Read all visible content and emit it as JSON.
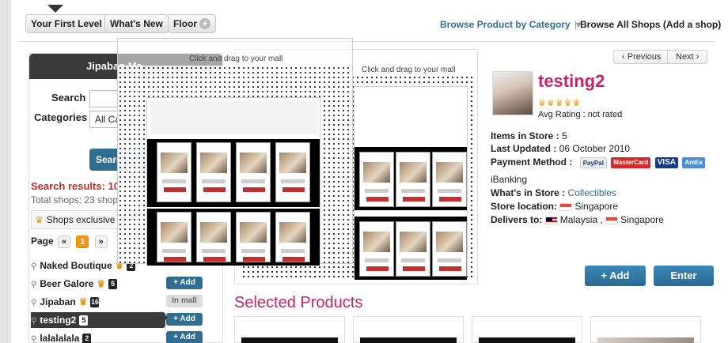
{
  "topnav": {
    "your_first_level": "Your First Level",
    "whats_new": "What's New",
    "floor": "Floor",
    "browse_category": "Browse Product by Category",
    "browse_all": "Browse All Shops (Add a shop)"
  },
  "left": {
    "header": "Jipaban Ma",
    "search_label": "Search",
    "categories_label": "Categories",
    "categories_value": "All Ca",
    "search_button": "Searc",
    "results": "Search results: 10",
    "total": "Total shops: 23 shop",
    "exclusive": "Shops exclusive to",
    "page_label": "Page",
    "page_prev": "«",
    "page_current": "1",
    "page_next": "»",
    "shops": [
      {
        "name": "Naked Boutique",
        "badge": "2",
        "action": ""
      },
      {
        "name": "Beer Galore",
        "badge": "5",
        "action": "+ Add"
      },
      {
        "name": "Jipaban",
        "badge": "16",
        "action": "In mall"
      },
      {
        "name": "testing2",
        "badge": "5",
        "action": "+ Add"
      },
      {
        "name": "lalalalala",
        "badge": "2",
        "action": "+ Add"
      }
    ]
  },
  "center": {
    "drag_hint": "Click and drag to your mall",
    "drag_hint2": "Click and drag to your mall"
  },
  "detail": {
    "prev": "Previous",
    "next": "Next",
    "shop_name": "testing2",
    "avg_rating": "Avg Rating : not rated",
    "items_label": "Items in Store :",
    "items_value": "5",
    "updated_label": "Last Updated :",
    "updated_value": "06 October 2010",
    "payment_label": "Payment Method :",
    "payment_methods": [
      "PayPal",
      "MasterCard",
      "VISA",
      "AmEx"
    ],
    "ibanking": "iBanking",
    "whats_label": "What's in Store :",
    "whats_value": "Collectibles",
    "location_label": "Store location:",
    "location_value": "Singapore",
    "delivers_label": "Delivers to:",
    "delivers_1": "Malaysia",
    "delivers_sep": ",",
    "delivers_2": "Singapore",
    "add_button": "+ Add",
    "enter_button": "Enter"
  },
  "selected_products": "Selected Products",
  "colors": {
    "accent_blue": "#2f6d91",
    "brand_pink": "#c3246a",
    "alert_red": "#c0302f",
    "crown_gold": "#e69a1c"
  }
}
